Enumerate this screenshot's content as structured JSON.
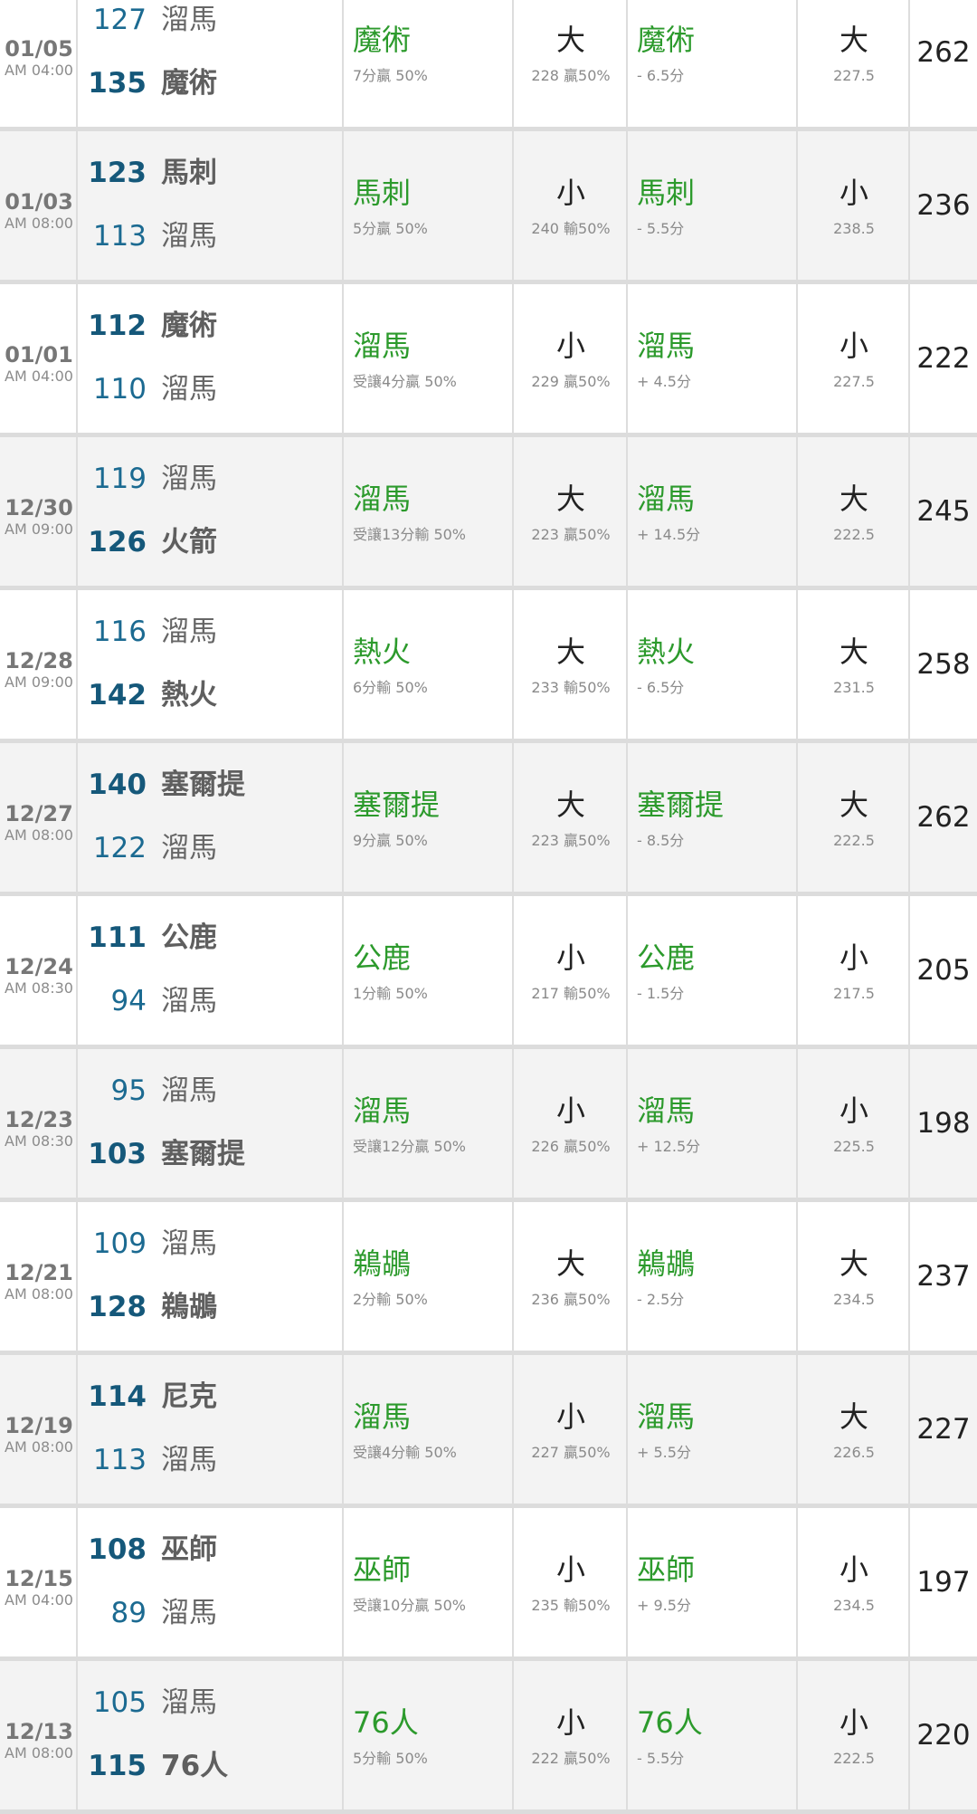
{
  "games": [
    {
      "date": "01/05",
      "time": "AM 04:00",
      "team1": {
        "score": "127",
        "name": "溜馬",
        "winner": false
      },
      "team2": {
        "score": "135",
        "name": "魔術",
        "winner": true
      },
      "pick": {
        "team": "魔術",
        "detail": "7分贏 50%"
      },
      "ou": {
        "result": "大",
        "detail": "228 贏50%"
      },
      "spread": {
        "team": "魔術",
        "line": "- 6.5分"
      },
      "ou2": {
        "result": "大",
        "line": "227.5"
      },
      "total": "262"
    },
    {
      "date": "01/03",
      "time": "AM 08:00",
      "team1": {
        "score": "123",
        "name": "馬刺",
        "winner": true
      },
      "team2": {
        "score": "113",
        "name": "溜馬",
        "winner": false
      },
      "pick": {
        "team": "馬刺",
        "detail": "5分贏 50%"
      },
      "ou": {
        "result": "小",
        "detail": "240 輸50%"
      },
      "spread": {
        "team": "馬刺",
        "line": "- 5.5分"
      },
      "ou2": {
        "result": "小",
        "line": "238.5"
      },
      "total": "236"
    },
    {
      "date": "01/01",
      "time": "AM 04:00",
      "team1": {
        "score": "112",
        "name": "魔術",
        "winner": true
      },
      "team2": {
        "score": "110",
        "name": "溜馬",
        "winner": false
      },
      "pick": {
        "team": "溜馬",
        "detail": "受讓4分贏 50%"
      },
      "ou": {
        "result": "小",
        "detail": "229 贏50%"
      },
      "spread": {
        "team": "溜馬",
        "line": "+ 4.5分"
      },
      "ou2": {
        "result": "小",
        "line": "227.5"
      },
      "total": "222"
    },
    {
      "date": "12/30",
      "time": "AM 09:00",
      "team1": {
        "score": "119",
        "name": "溜馬",
        "winner": false
      },
      "team2": {
        "score": "126",
        "name": "火箭",
        "winner": true
      },
      "pick": {
        "team": "溜馬",
        "detail": "受讓13分輸 50%"
      },
      "ou": {
        "result": "大",
        "detail": "223 贏50%"
      },
      "spread": {
        "team": "溜馬",
        "line": "+ 14.5分"
      },
      "ou2": {
        "result": "大",
        "line": "222.5"
      },
      "total": "245"
    },
    {
      "date": "12/28",
      "time": "AM 09:00",
      "team1": {
        "score": "116",
        "name": "溜馬",
        "winner": false
      },
      "team2": {
        "score": "142",
        "name": "熱火",
        "winner": true
      },
      "pick": {
        "team": "熱火",
        "detail": "6分輸 50%"
      },
      "ou": {
        "result": "大",
        "detail": "233 輸50%"
      },
      "spread": {
        "team": "熱火",
        "line": "- 6.5分"
      },
      "ou2": {
        "result": "大",
        "line": "231.5"
      },
      "total": "258"
    },
    {
      "date": "12/27",
      "time": "AM 08:00",
      "team1": {
        "score": "140",
        "name": "塞爾提",
        "winner": true
      },
      "team2": {
        "score": "122",
        "name": "溜馬",
        "winner": false
      },
      "pick": {
        "team": "塞爾提",
        "detail": "9分贏 50%"
      },
      "ou": {
        "result": "大",
        "detail": "223 贏50%"
      },
      "spread": {
        "team": "塞爾提",
        "line": "- 8.5分"
      },
      "ou2": {
        "result": "大",
        "line": "222.5"
      },
      "total": "262"
    },
    {
      "date": "12/24",
      "time": "AM 08:30",
      "team1": {
        "score": "111",
        "name": "公鹿",
        "winner": true
      },
      "team2": {
        "score": "94",
        "name": "溜馬",
        "winner": false
      },
      "pick": {
        "team": "公鹿",
        "detail": "1分輸 50%"
      },
      "ou": {
        "result": "小",
        "detail": "217 輸50%"
      },
      "spread": {
        "team": "公鹿",
        "line": "- 1.5分"
      },
      "ou2": {
        "result": "小",
        "line": "217.5"
      },
      "total": "205"
    },
    {
      "date": "12/23",
      "time": "AM 08:30",
      "team1": {
        "score": "95",
        "name": "溜馬",
        "winner": false
      },
      "team2": {
        "score": "103",
        "name": "塞爾提",
        "winner": true
      },
      "pick": {
        "team": "溜馬",
        "detail": "受讓12分贏 50%"
      },
      "ou": {
        "result": "小",
        "detail": "226 贏50%"
      },
      "spread": {
        "team": "溜馬",
        "line": "+ 12.5分"
      },
      "ou2": {
        "result": "小",
        "line": "225.5"
      },
      "total": "198"
    },
    {
      "date": "12/21",
      "time": "AM 08:00",
      "team1": {
        "score": "109",
        "name": "溜馬",
        "winner": false
      },
      "team2": {
        "score": "128",
        "name": "鵜鶘",
        "winner": true
      },
      "pick": {
        "team": "鵜鶘",
        "detail": "2分輸 50%"
      },
      "ou": {
        "result": "大",
        "detail": "236 贏50%"
      },
      "spread": {
        "team": "鵜鶘",
        "line": "- 2.5分"
      },
      "ou2": {
        "result": "大",
        "line": "234.5"
      },
      "total": "237"
    },
    {
      "date": "12/19",
      "time": "AM 08:00",
      "team1": {
        "score": "114",
        "name": "尼克",
        "winner": true
      },
      "team2": {
        "score": "113",
        "name": "溜馬",
        "winner": false
      },
      "pick": {
        "team": "溜馬",
        "detail": "受讓4分輸 50%"
      },
      "ou": {
        "result": "小",
        "detail": "227 贏50%"
      },
      "spread": {
        "team": "溜馬",
        "line": "+ 5.5分"
      },
      "ou2": {
        "result": "大",
        "line": "226.5"
      },
      "total": "227"
    },
    {
      "date": "12/15",
      "time": "AM 04:00",
      "team1": {
        "score": "108",
        "name": "巫師",
        "winner": true
      },
      "team2": {
        "score": "89",
        "name": "溜馬",
        "winner": false
      },
      "pick": {
        "team": "巫師",
        "detail": "受讓10分贏 50%"
      },
      "ou": {
        "result": "小",
        "detail": "235 輸50%"
      },
      "spread": {
        "team": "巫師",
        "line": "+ 9.5分"
      },
      "ou2": {
        "result": "小",
        "line": "234.5"
      },
      "total": "197"
    },
    {
      "date": "12/13",
      "time": "AM 08:00",
      "team1": {
        "score": "105",
        "name": "溜馬",
        "winner": false
      },
      "team2": {
        "score": "115",
        "name": "76人",
        "winner": true
      },
      "pick": {
        "team": "76人",
        "detail": "5分輸 50%"
      },
      "ou": {
        "result": "小",
        "detail": "222 贏50%"
      },
      "spread": {
        "team": "76人",
        "line": "- 5.5分"
      },
      "ou2": {
        "result": "小",
        "line": "222.5"
      },
      "total": "220"
    }
  ],
  "colors": {
    "pick_green": "#2c9a2c",
    "score_blue": "#1b6a91",
    "row_alt": "#f3f3f3"
  }
}
